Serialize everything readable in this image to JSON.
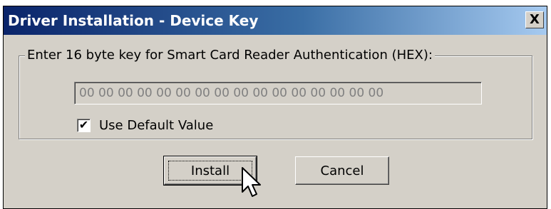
{
  "window": {
    "title": "Driver Installation - Device Key",
    "close_glyph": "X"
  },
  "group": {
    "label": "Enter 16 byte key for Smart Card Reader Authentication (HEX):"
  },
  "key_field": {
    "value": "00 00 00 00 00 00 00 00 00 00 00 00 00 00 00 00",
    "disabled": true
  },
  "default_checkbox": {
    "label": "Use Default Value",
    "checked": true,
    "mark": "✔"
  },
  "buttons": {
    "install": "Install",
    "cancel": "Cancel"
  },
  "icons": {
    "close": "close-icon",
    "cursor": "mouse-pointer-icon"
  }
}
